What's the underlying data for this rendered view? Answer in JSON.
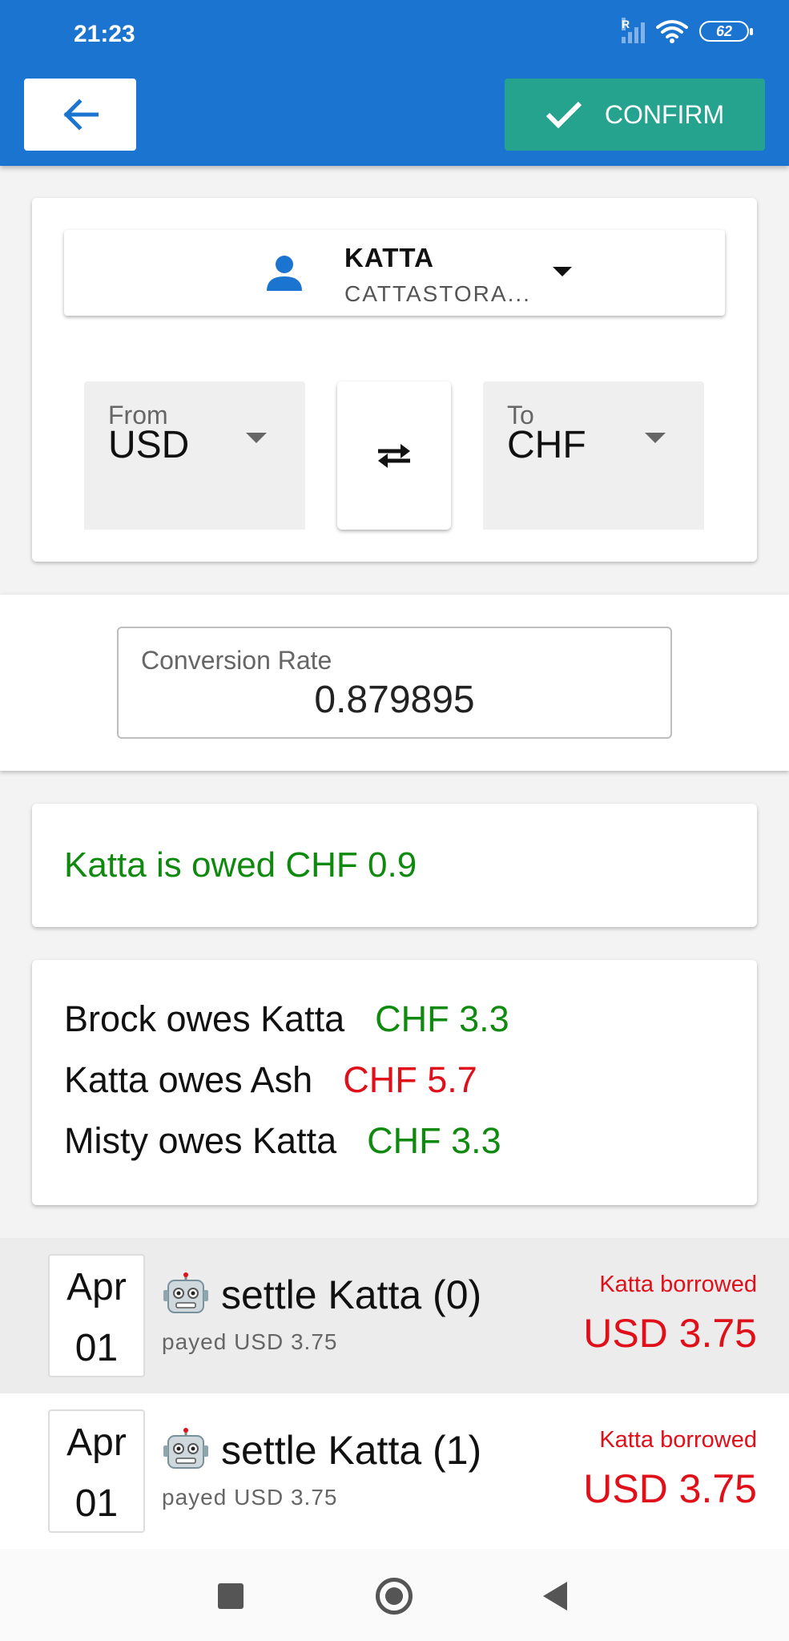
{
  "status_bar": {
    "time": "21:23",
    "network_label": "R",
    "battery": "62"
  },
  "toolbar": {
    "back_icon": "arrow-left-icon",
    "confirm_label": "CONFIRM",
    "confirm_icon": "check-icon"
  },
  "user_select": {
    "name": "KATTA",
    "subtitle": "CATTASTORA...",
    "icon": "person-icon"
  },
  "currency": {
    "from_label": "From",
    "from_value": "USD",
    "to_label": "To",
    "to_value": "CHF",
    "swap_icon": "swap-arrows-icon"
  },
  "conversion": {
    "label": "Conversion Rate",
    "value": "0.879895"
  },
  "summary": {
    "text": "Katta is owed CHF 0.9",
    "color": "#0f8a0f"
  },
  "debts": [
    {
      "text": "Brock owes Katta",
      "amount": "CHF 3.3",
      "status": "positive"
    },
    {
      "text": "Katta owes Ash",
      "amount": "CHF 5.7",
      "status": "negative"
    },
    {
      "text": "Misty owes Katta",
      "amount": "CHF 3.3",
      "status": "positive"
    }
  ],
  "transactions": [
    {
      "month": "Apr",
      "day": "01",
      "icon": "robot-icon",
      "title": "settle Katta (0)",
      "subtitle": "payed USD 3.75",
      "right_label": "Katta borrowed",
      "right_amount": "USD 3.75"
    },
    {
      "month": "Apr",
      "day": "01",
      "icon": "robot-icon",
      "title": "settle Katta (1)",
      "subtitle": "payed USD 3.75",
      "right_label": "Katta borrowed",
      "right_amount": "USD 3.75"
    }
  ],
  "colors": {
    "primary": "#1c74d1",
    "confirm": "#25a38f",
    "positive": "#0f8a0f",
    "negative": "#e0101a"
  },
  "nav": {
    "icons": [
      "recents-square-icon",
      "home-circle-icon",
      "back-triangle-icon"
    ]
  }
}
